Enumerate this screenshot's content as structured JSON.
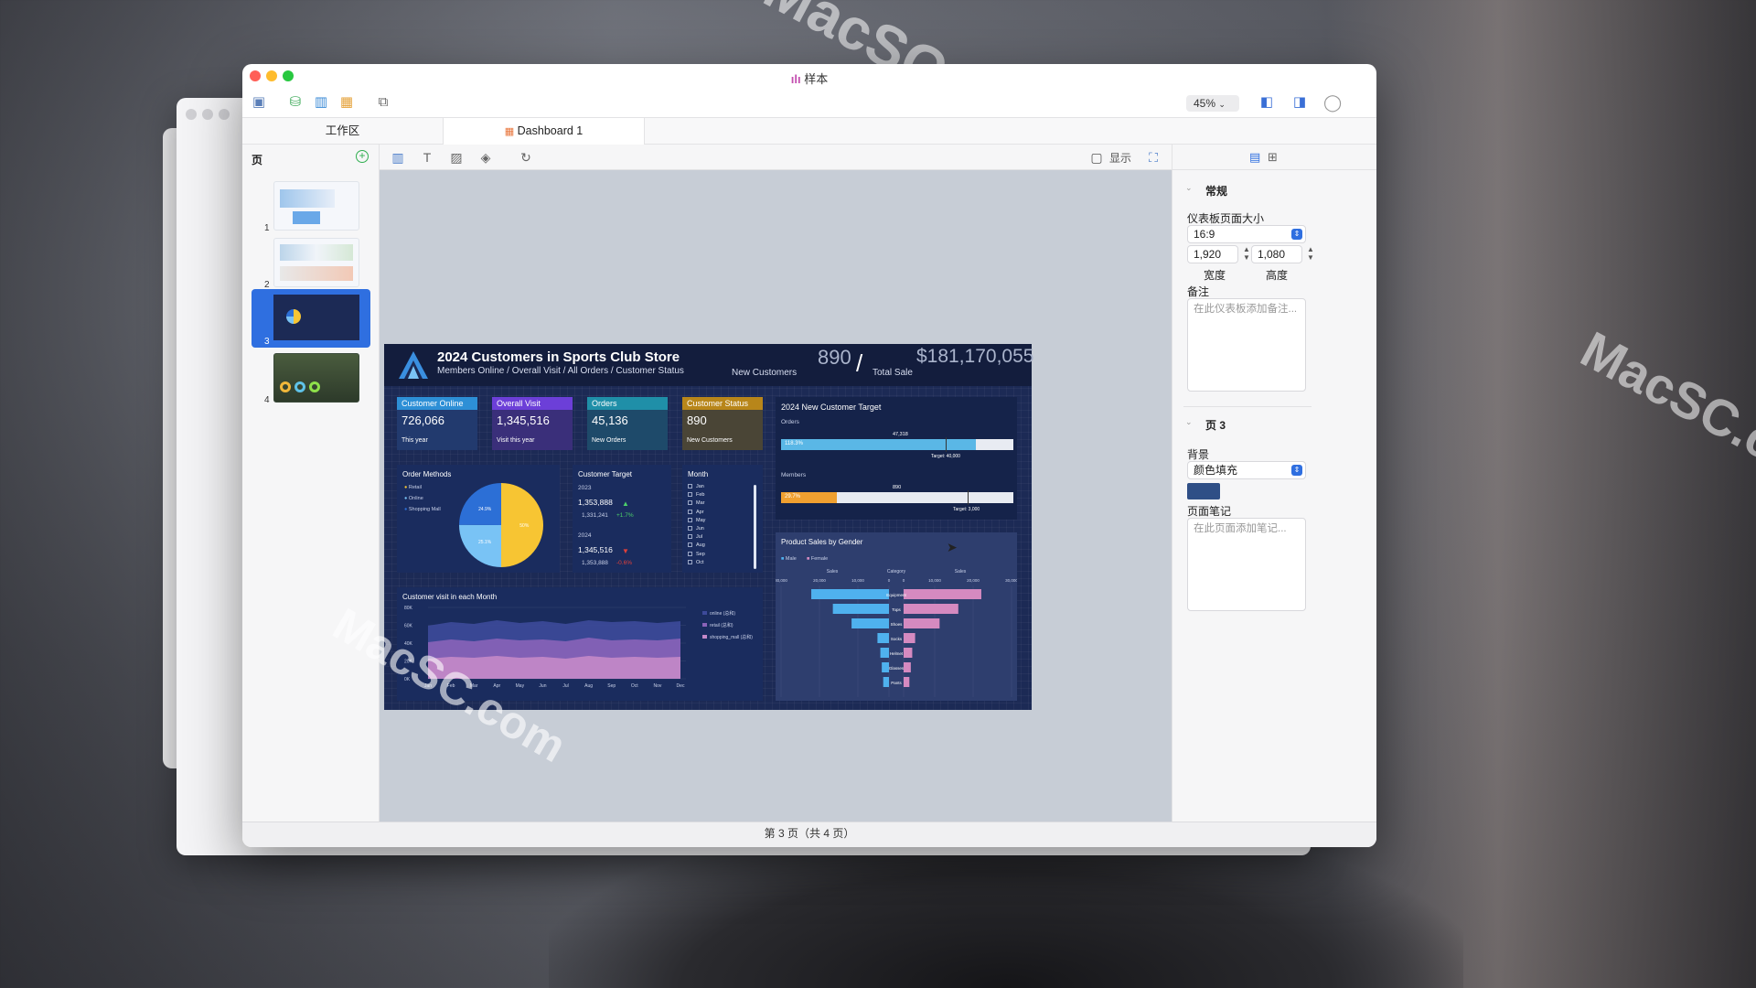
{
  "window": {
    "title": "样本",
    "zoom": "45%",
    "tabs": [
      "工作区",
      "Dashboard 1"
    ],
    "status": "第 3 页（共 4 页）",
    "present_label": "显示"
  },
  "pages": {
    "header": "页",
    "numbers": [
      "1",
      "2",
      "3",
      "4"
    ]
  },
  "inspector": {
    "section_general": "常规",
    "size_label": "仪表板页面大小",
    "size_value": "16:9",
    "width": "1,920",
    "height": "1,080",
    "width_label": "宽度",
    "height_label": "高度",
    "notes_label": "备注",
    "notes_placeholder": "在此仪表板添加备注...",
    "section_page": "页 3",
    "background_label": "背景",
    "background_value": "颜色填充",
    "background_color": "#2f4f86",
    "page_notes_label": "页面笔记",
    "page_notes_placeholder": "在此页面添加笔记..."
  },
  "watermarks": [
    "MacSC.com",
    "MacSC.com",
    "MacSC.c",
    "MacSC.com"
  ],
  "dashboard": {
    "title": "2024 Customers in Sports Club Store",
    "subtitle": "Members Online / Overall Visit / All Orders / Customer Status",
    "new_customers_value": "890",
    "new_customers_label": "New Customers",
    "total_sale_value": "$181,170,055",
    "total_sale_label": "Total Sale",
    "kpis": [
      {
        "title": "Customer Online",
        "value": "726,066",
        "sub": "This year",
        "color": "#2d8fd6"
      },
      {
        "title": "Overall Visit",
        "value": "1,345,516",
        "sub": "Visit this year",
        "color": "#6c3fd8"
      },
      {
        "title": "Orders",
        "value": "45,136",
        "sub": "New Orders",
        "color": "#1f8fa8"
      },
      {
        "title": "Customer Status",
        "value": "890",
        "sub": "New Customers",
        "color": "#b8861a"
      }
    ],
    "order_methods": {
      "title": "Order Methods",
      "legend": [
        "Retail",
        "Online",
        "Shopping Mall"
      ],
      "slices": [
        {
          "label": "Retail",
          "pct": 50.0,
          "text": "50%",
          "color": "#f7c533"
        },
        {
          "label": "Online",
          "pct": 25.1,
          "text": "25.1%",
          "color": "#79c3f5"
        },
        {
          "label": "Shopping Mall",
          "pct": 24.9,
          "text": "24.9%",
          "color": "#2c6fd6"
        }
      ]
    },
    "customer_target": {
      "title": "Customer Target",
      "y2023": "2023",
      "v2023": "1,353,888",
      "v2023_prev": "1,331,241",
      "v2023_delta": "+1.7%",
      "y2024": "2024",
      "v2024": "1,345,516",
      "v2024_prev": "1,353,888",
      "v2024_delta": "-0.6%"
    },
    "month": {
      "title": "Month",
      "items": [
        "Jan",
        "Feb",
        "Mar",
        "Apr",
        "May",
        "Jun",
        "Jul",
        "Aug",
        "Sep",
        "Oct"
      ]
    },
    "new_customer_target": {
      "title": "2024 New Customer Target",
      "orders_label": "Orders",
      "orders_value": "47,318",
      "orders_pct_text": "118.3%",
      "orders_fill": 0.84,
      "orders_target": "Target: 40,000",
      "members_label": "Members",
      "members_value": "890",
      "members_pct_text": "29.7%",
      "members_fill": 0.24,
      "members_target": "Target: 3,000"
    },
    "visits": {
      "title": "Customer visit in each Month",
      "yticks": [
        "80K",
        "60K",
        "40K",
        "20K",
        "0K"
      ],
      "xticks": [
        "Jan",
        "Feb",
        "Mar",
        "Apr",
        "May",
        "Jun",
        "Jul",
        "Aug",
        "Sep",
        "Oct",
        "Nov",
        "Dec"
      ],
      "legend": [
        "online (总和)",
        "retail (总和)",
        "shopping_mall (总和)"
      ]
    },
    "gender_sales": {
      "title": "Product Sales by Gender",
      "legend": [
        "Male",
        "Female"
      ],
      "left_axis": "Sales",
      "center_axis": "Category",
      "right_axis": "Sales",
      "ticks": [
        "30,000",
        "20,000",
        "10,000",
        "0",
        "0",
        "10,000",
        "20,000",
        "30,000"
      ],
      "categories": [
        "Equipment",
        "Tops",
        "Shoes",
        "Socks",
        "Helmet",
        "Glasses",
        "Pants"
      ],
      "male": [
        27000,
        19500,
        13000,
        4000,
        3000,
        2500,
        2000
      ],
      "female": [
        27000,
        19000,
        12500,
        4000,
        3000,
        2500,
        2000
      ]
    }
  }
}
